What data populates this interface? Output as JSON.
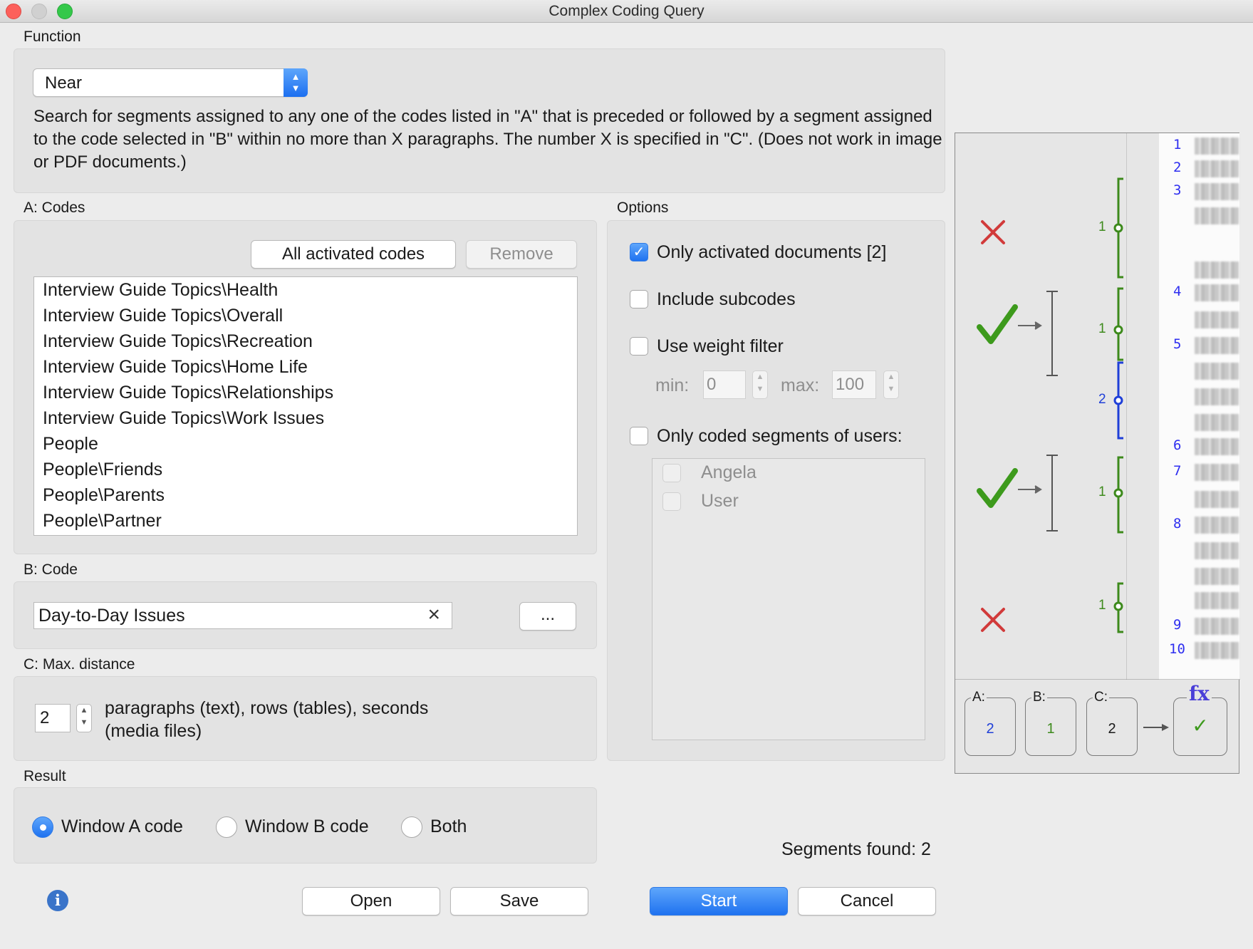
{
  "window": {
    "title": "Complex Coding Query"
  },
  "function": {
    "label": "Function",
    "selected": "Near",
    "description": "Search for segments assigned to any one of the codes listed in \"A\" that is preceded or followed by a segment assigned to the code selected in \"B\" within no more than X paragraphs. The number X is specified in \"C\". (Does not work in image or PDF documents.)"
  },
  "codes": {
    "label": "A: Codes",
    "all_activated_label": "All activated codes",
    "remove_label": "Remove",
    "items": [
      "Interview Guide Topics\\Health",
      "Interview Guide Topics\\Overall",
      "Interview Guide Topics\\Recreation",
      "Interview Guide Topics\\Home Life",
      "Interview Guide Topics\\Relationships",
      "Interview Guide Topics\\Work Issues",
      "People",
      "People\\Friends",
      "People\\Parents",
      "People\\Partner"
    ]
  },
  "code_b": {
    "label": "B: Code",
    "value": "Day-to-Day Issues",
    "clear_icon": "×",
    "browse_label": "..."
  },
  "max_distance": {
    "label": "C: Max. distance",
    "value": "2",
    "unit_text_line1": "paragraphs (text), rows (tables), seconds",
    "unit_text_line2": "(media files)"
  },
  "options": {
    "label": "Options",
    "only_activated_docs": {
      "label": "Only activated documents [2]",
      "checked": true
    },
    "include_subcodes": {
      "label": "Include subcodes",
      "checked": false
    },
    "use_weight_filter": {
      "label": "Use weight filter",
      "checked": false
    },
    "min_label": "min:",
    "min_value": "0",
    "max_label": "max:",
    "max_value": "100",
    "only_coded_segments_users": {
      "label": "Only coded segments of users:",
      "checked": false
    },
    "users": [
      "Angela",
      "User"
    ]
  },
  "result": {
    "label": "Result",
    "options": [
      "Window A code",
      "Window B code",
      "Both"
    ],
    "selected": "Window A code"
  },
  "segments_found": "Segments found: 2",
  "buttons": {
    "open": "Open",
    "save": "Save",
    "start": "Start",
    "cancel": "Cancel"
  },
  "diagram": {
    "line_numbers": [
      "1",
      "2",
      "3",
      "4",
      "5",
      "6",
      "7",
      "8",
      "9",
      "10"
    ],
    "bracket_labels": [
      "1",
      "1",
      "2",
      "1",
      "1"
    ],
    "boxes": [
      {
        "label": "A:",
        "value": "2"
      },
      {
        "label": "B:",
        "value": "1"
      },
      {
        "label": "C:",
        "value": "2"
      }
    ],
    "fx_label": "fx",
    "result_mark": "✓"
  },
  "colors": {
    "accent": "#1f72f0",
    "check_green": "#3d9a1c",
    "cross_red": "#d13a3a",
    "line_blue": "#2e2ef0"
  }
}
